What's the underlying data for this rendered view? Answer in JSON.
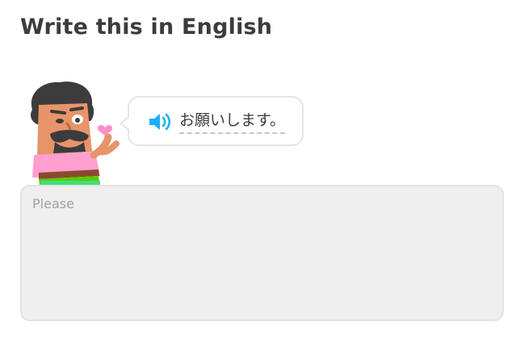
{
  "header": {
    "title": "Write this in English"
  },
  "prompt": {
    "text": "お願いします。",
    "audio_icon": "speaker-icon"
  },
  "answer": {
    "placeholder": "Please",
    "value": ""
  },
  "colors": {
    "title": "#3c3c3c",
    "speaker": "#1cb0f6",
    "answer_bg": "#efefef",
    "border": "#e5e5e5"
  }
}
